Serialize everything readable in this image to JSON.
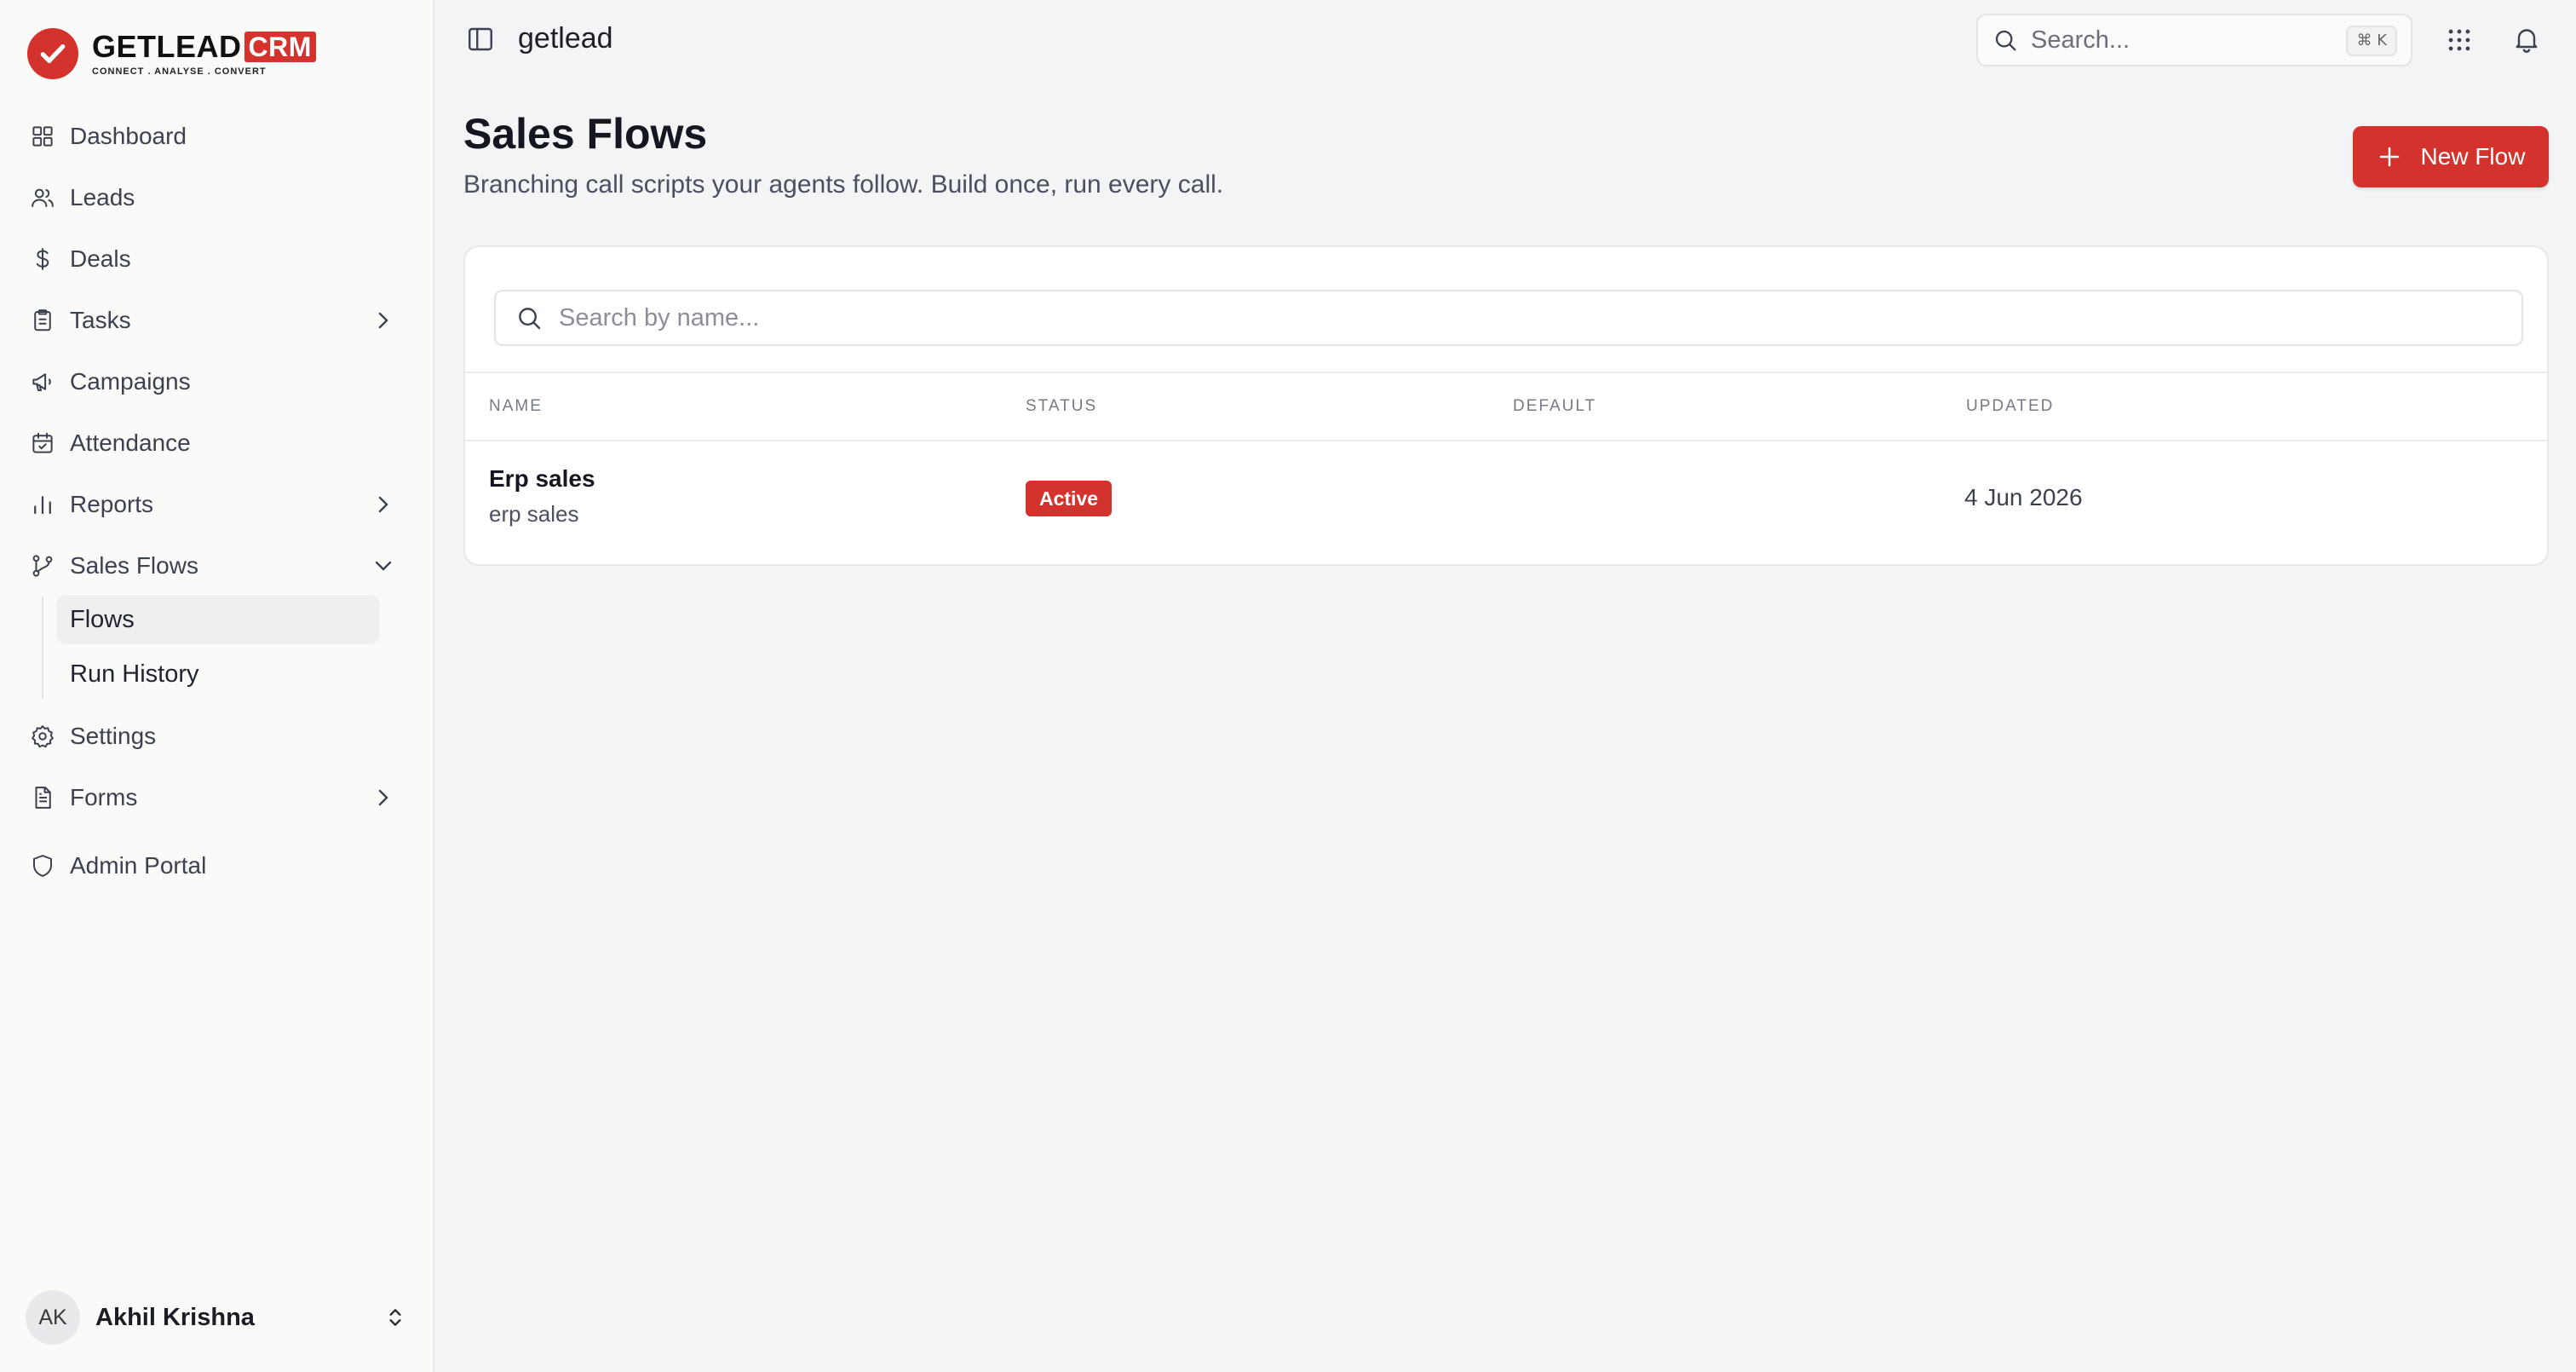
{
  "brand": {
    "name": "GETLEAD",
    "suffix": "CRM",
    "tagline": "CONNECT  .  ANALYSE  .  CONVERT",
    "accent": "#d4322c"
  },
  "sidebar": {
    "items": [
      {
        "label": "Dashboard",
        "icon": "dashboard-icon"
      },
      {
        "label": "Leads",
        "icon": "users-icon"
      },
      {
        "label": "Deals",
        "icon": "dollar-icon"
      },
      {
        "label": "Tasks",
        "icon": "clipboard-icon"
      },
      {
        "label": "Campaigns",
        "icon": "megaphone-icon"
      },
      {
        "label": "Attendance",
        "icon": "calendar-check-icon"
      },
      {
        "label": "Reports",
        "icon": "bar-chart-icon"
      },
      {
        "label": "Sales Flows",
        "icon": "git-branch-icon"
      },
      {
        "label": "Settings",
        "icon": "gear-icon"
      },
      {
        "label": "Forms",
        "icon": "file-text-icon"
      },
      {
        "label": "Admin Portal",
        "icon": "shield-icon"
      }
    ],
    "sub_items": [
      {
        "label": "Flows"
      },
      {
        "label": "Run History"
      }
    ],
    "user": {
      "initials": "AK",
      "name": "Akhil Krishna"
    }
  },
  "topbar": {
    "workspace": "getlead",
    "search_placeholder": "Search...",
    "shortcut": "⌘ K"
  },
  "main": {
    "title": "Sales Flows",
    "subtitle": "Branching call scripts your agents follow. Build once, run every call.",
    "new_button": "New Flow",
    "search_placeholder": "Search by name...",
    "columns": [
      "NAME",
      "STATUS",
      "DEFAULT",
      "UPDATED"
    ],
    "rows": [
      {
        "name": "Erp sales",
        "description": "erp sales",
        "status": "Active",
        "default": "",
        "updated": "4 Jun 2026"
      }
    ]
  }
}
